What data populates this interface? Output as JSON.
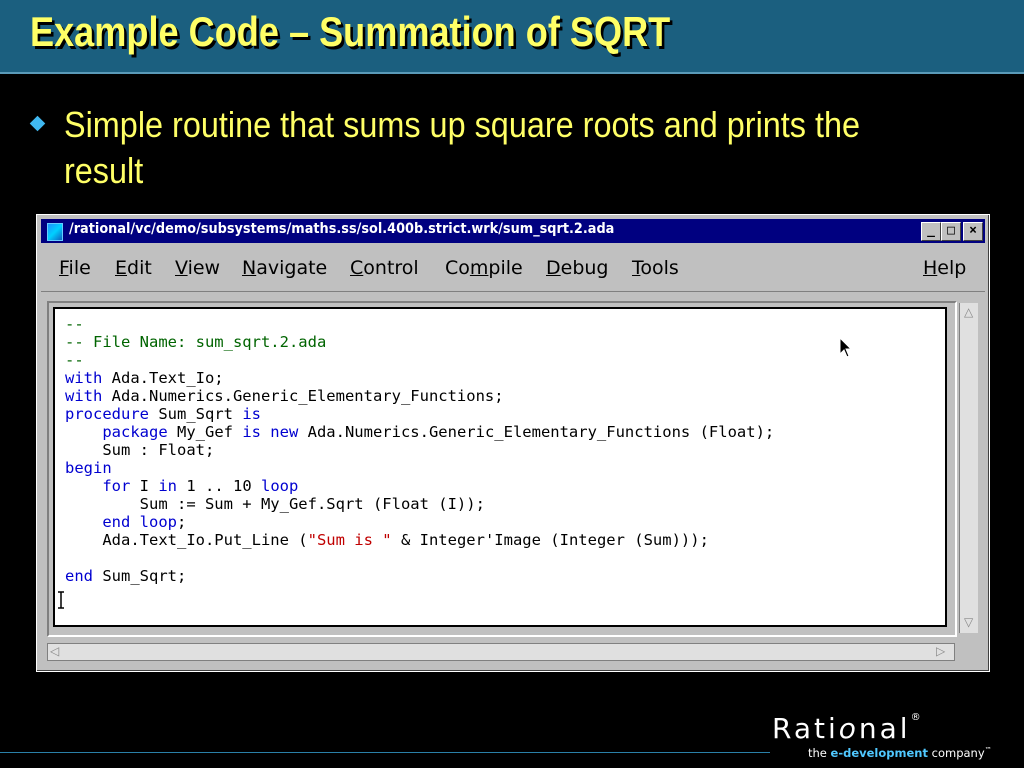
{
  "slide": {
    "title": "Example Code – Summation of SQRT",
    "bullet": "Simple routine that sums up square roots and prints the result"
  },
  "window": {
    "title": "/rational/vc/demo/subsystems/maths.ss/sol.400b.strict.wrk/sum_sqrt.2.ada",
    "buttons": {
      "minimize": "_",
      "maximize": "□",
      "close": "×"
    },
    "menu": [
      {
        "pre": "",
        "ul": "F",
        "post": "ile"
      },
      {
        "pre": "",
        "ul": "E",
        "post": "dit"
      },
      {
        "pre": "",
        "ul": "V",
        "post": "iew"
      },
      {
        "pre": "",
        "ul": "N",
        "post": "avigate"
      },
      {
        "pre": "",
        "ul": "C",
        "post": "ontrol"
      },
      {
        "pre": "Co",
        "ul": "m",
        "post": "pile"
      },
      {
        "pre": "",
        "ul": "D",
        "post": "ebug"
      },
      {
        "pre": "",
        "ul": "T",
        "post": "ools"
      },
      {
        "pre": "",
        "ul": "H",
        "post": "elp"
      }
    ],
    "code_lines": [
      [
        {
          "t": "--",
          "c": "cm"
        }
      ],
      [
        {
          "t": "-- File Name: sum_sqrt.2.ada",
          "c": "cm"
        }
      ],
      [
        {
          "t": "--",
          "c": "cm"
        }
      ],
      [
        {
          "t": "with",
          "c": "kw"
        },
        {
          "t": " Ada.Text_Io;",
          "c": ""
        }
      ],
      [
        {
          "t": "with",
          "c": "kw"
        },
        {
          "t": " Ada.Numerics.Generic_Elementary_Functions;",
          "c": ""
        }
      ],
      [
        {
          "t": "procedure",
          "c": "kw"
        },
        {
          "t": " Sum_Sqrt ",
          "c": ""
        },
        {
          "t": "is",
          "c": "kw"
        }
      ],
      [
        {
          "t": "    ",
          "c": ""
        },
        {
          "t": "package",
          "c": "kw"
        },
        {
          "t": " My_Gef ",
          "c": ""
        },
        {
          "t": "is new",
          "c": "kw"
        },
        {
          "t": " Ada.Numerics.Generic_Elementary_Functions (Float);",
          "c": ""
        }
      ],
      [
        {
          "t": "    Sum : Float;",
          "c": ""
        }
      ],
      [
        {
          "t": "begin",
          "c": "kw"
        }
      ],
      [
        {
          "t": "    ",
          "c": ""
        },
        {
          "t": "for",
          "c": "kw"
        },
        {
          "t": " I ",
          "c": ""
        },
        {
          "t": "in",
          "c": "kw"
        },
        {
          "t": " 1 .. 10 ",
          "c": ""
        },
        {
          "t": "loop",
          "c": "kw"
        }
      ],
      [
        {
          "t": "        Sum := Sum + My_Gef.Sqrt (Float (I));",
          "c": ""
        }
      ],
      [
        {
          "t": "    ",
          "c": ""
        },
        {
          "t": "end loop",
          "c": "kw"
        },
        {
          "t": ";",
          "c": ""
        }
      ],
      [
        {
          "t": "    Ada.Text_Io.Put_Line (",
          "c": ""
        },
        {
          "t": "\"Sum is \"",
          "c": "str"
        },
        {
          "t": " & Integer'Image (Integer (Sum)));",
          "c": ""
        }
      ],
      [
        {
          "t": "",
          "c": ""
        }
      ],
      [
        {
          "t": "end",
          "c": "kw"
        },
        {
          "t": " Sum_Sqrt;",
          "c": ""
        }
      ]
    ]
  },
  "logo": {
    "word_pre": "Rati",
    "word_o": "o",
    "word_post": "nal",
    "reg": "®",
    "tag_pre": "the ",
    "tag_bold": "e-development",
    "tag_post": " company",
    "tm": "™"
  }
}
